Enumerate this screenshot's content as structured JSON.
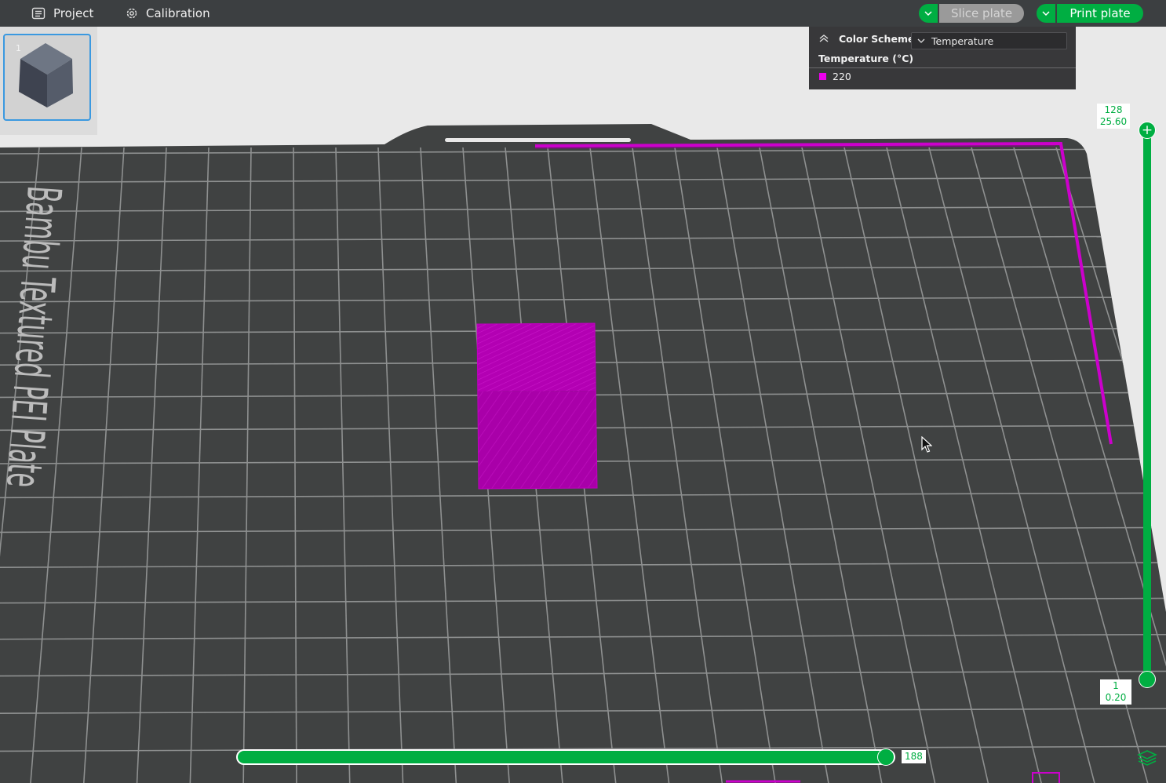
{
  "topbar": {
    "project_label": "Project",
    "calibration_label": "Calibration",
    "slice_label": "Slice plate",
    "print_label": "Print plate",
    "accent_color": "#00ae42"
  },
  "plate": {
    "thumbnail_number": "1",
    "bed_text": "Bambu Textured PEI Plate",
    "model_color": "#b000b0"
  },
  "legend": {
    "title": "Color Scheme",
    "scheme_value": "Temperature",
    "subtitle": "Temperature (°C)",
    "entries": [
      {
        "value": "220",
        "color": "#ee00ee"
      }
    ]
  },
  "layer_slider": {
    "top_layer": "128",
    "top_height": "25.60",
    "bottom_layer": "1",
    "bottom_height": "0.20"
  },
  "move_slider": {
    "value": "188"
  },
  "icons": [
    "project-icon",
    "calibration-icon",
    "chevron-down-icon",
    "collapse-icon",
    "layers-icon",
    "cursor-icon"
  ]
}
